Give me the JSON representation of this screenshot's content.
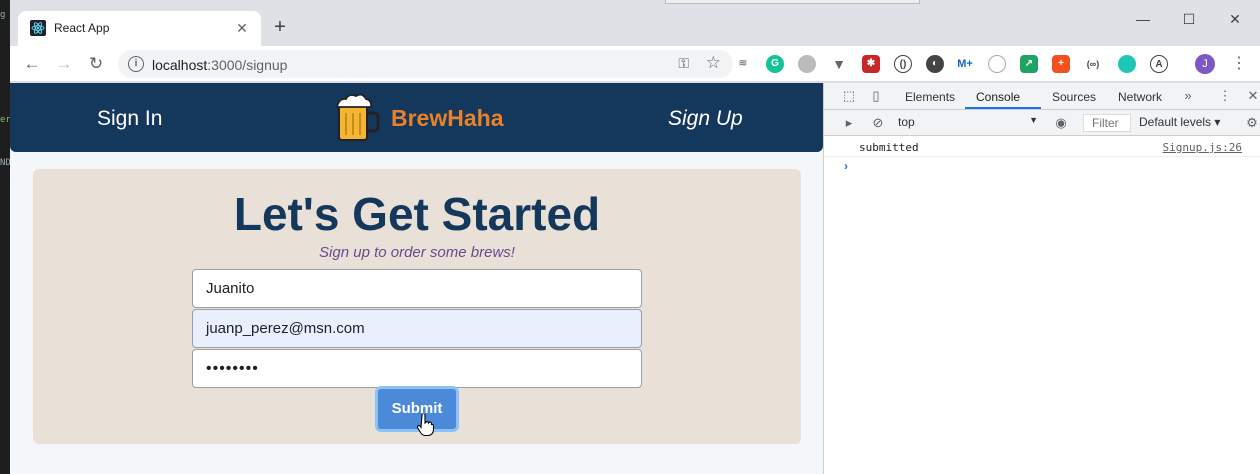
{
  "browser": {
    "tab_title": "React App",
    "new_tab": "+",
    "url_host": "localhost",
    "url_path": ":3000/signup",
    "profile_initial": "J",
    "window": {
      "minimize": "—",
      "maximize": "☐",
      "close": "✕"
    }
  },
  "app": {
    "nav": {
      "sign_in": "Sign In",
      "brand": "BrewHaha",
      "sign_up": "Sign Up"
    },
    "form": {
      "heading": "Let's Get Started",
      "subheading": "Sign up to order some brews!",
      "username_value": "Juanito",
      "email_value": "juanp_perez@msn.com",
      "password_value": "••••••••",
      "submit_label": "Submit"
    },
    "colors": {
      "navbar": "#14385c",
      "brand": "#e8812a",
      "card": "#e9e0d8",
      "button": "#4a8ad8"
    }
  },
  "devtools": {
    "tabs": [
      "Elements",
      "Console",
      "Sources",
      "Network"
    ],
    "active_tab": "Console",
    "context": "top",
    "filter_placeholder": "Filter",
    "levels": "Default levels",
    "console_messages": [
      {
        "text": "submitted",
        "source": "Signup.js:26"
      }
    ],
    "prompt": "›"
  }
}
